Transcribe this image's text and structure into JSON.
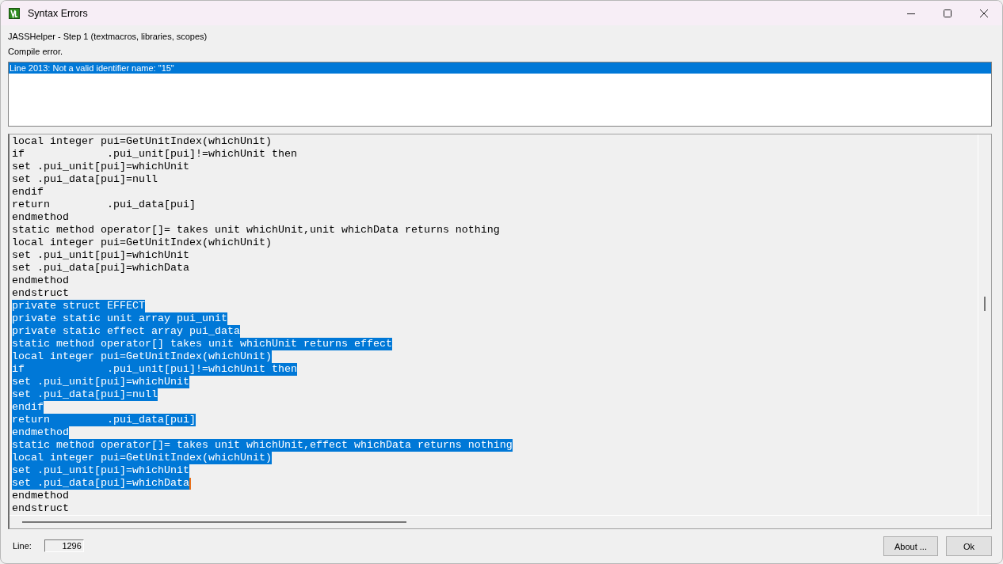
{
  "window": {
    "title": "Syntax Errors"
  },
  "header_lines": [
    "JASSHelper - Step 1 (textmacros, libraries, scopes)",
    "Compile error."
  ],
  "errors": [
    {
      "text": "Line 2013: Not a valid identifier name: \"15\"",
      "selected": true
    }
  ],
  "code_lines": [
    {
      "text": "local integer pui=GetUnitIndex(whichUnit)",
      "selected": false,
      "caret": false
    },
    {
      "text": "if             .pui_unit[pui]!=whichUnit then",
      "selected": false,
      "caret": false
    },
    {
      "text": "set .pui_unit[pui]=whichUnit",
      "selected": false,
      "caret": false
    },
    {
      "text": "set .pui_data[pui]=null",
      "selected": false,
      "caret": false
    },
    {
      "text": "endif",
      "selected": false,
      "caret": false
    },
    {
      "text": "return         .pui_data[pui]",
      "selected": false,
      "caret": false
    },
    {
      "text": "endmethod",
      "selected": false,
      "caret": false
    },
    {
      "text": "static method operator[]= takes unit whichUnit,unit whichData returns nothing",
      "selected": false,
      "caret": false
    },
    {
      "text": "local integer pui=GetUnitIndex(whichUnit)",
      "selected": false,
      "caret": false
    },
    {
      "text": "set .pui_unit[pui]=whichUnit",
      "selected": false,
      "caret": false
    },
    {
      "text": "set .pui_data[pui]=whichData",
      "selected": false,
      "caret": false
    },
    {
      "text": "endmethod",
      "selected": false,
      "caret": false
    },
    {
      "text": "endstruct",
      "selected": false,
      "caret": false
    },
    {
      "text": "private struct EFFECT",
      "selected": true,
      "caret": false
    },
    {
      "text": "private static unit array pui_unit",
      "selected": true,
      "caret": false
    },
    {
      "text": "private static effect array pui_data",
      "selected": true,
      "caret": false
    },
    {
      "text": "static method operator[] takes unit whichUnit returns effect",
      "selected": true,
      "caret": false
    },
    {
      "text": "local integer pui=GetUnitIndex(whichUnit)",
      "selected": true,
      "caret": false
    },
    {
      "text": "if             .pui_unit[pui]!=whichUnit then",
      "selected": true,
      "caret": false
    },
    {
      "text": "set .pui_unit[pui]=whichUnit",
      "selected": true,
      "caret": false
    },
    {
      "text": "set .pui_data[pui]=null",
      "selected": true,
      "caret": false
    },
    {
      "text": "endif",
      "selected": true,
      "caret": false
    },
    {
      "text": "return         .pui_data[pui]",
      "selected": true,
      "caret": false
    },
    {
      "text": "endmethod",
      "selected": true,
      "caret": false
    },
    {
      "text": "static method operator[]= takes unit whichUnit,effect whichData returns nothing",
      "selected": true,
      "caret": false
    },
    {
      "text": "local integer pui=GetUnitIndex(whichUnit)",
      "selected": true,
      "caret": false
    },
    {
      "text": "set .pui_unit[pui]=whichUnit",
      "selected": true,
      "caret": false
    },
    {
      "text": "set .pui_data[pui]=whichData",
      "selected": true,
      "caret": true
    },
    {
      "text": "endmethod",
      "selected": false,
      "caret": false
    },
    {
      "text": "endstruct",
      "selected": false,
      "caret": false
    }
  ],
  "line_field": {
    "label": "Line:",
    "value": "1296"
  },
  "buttons": [
    "About ...",
    "Ok"
  ]
}
